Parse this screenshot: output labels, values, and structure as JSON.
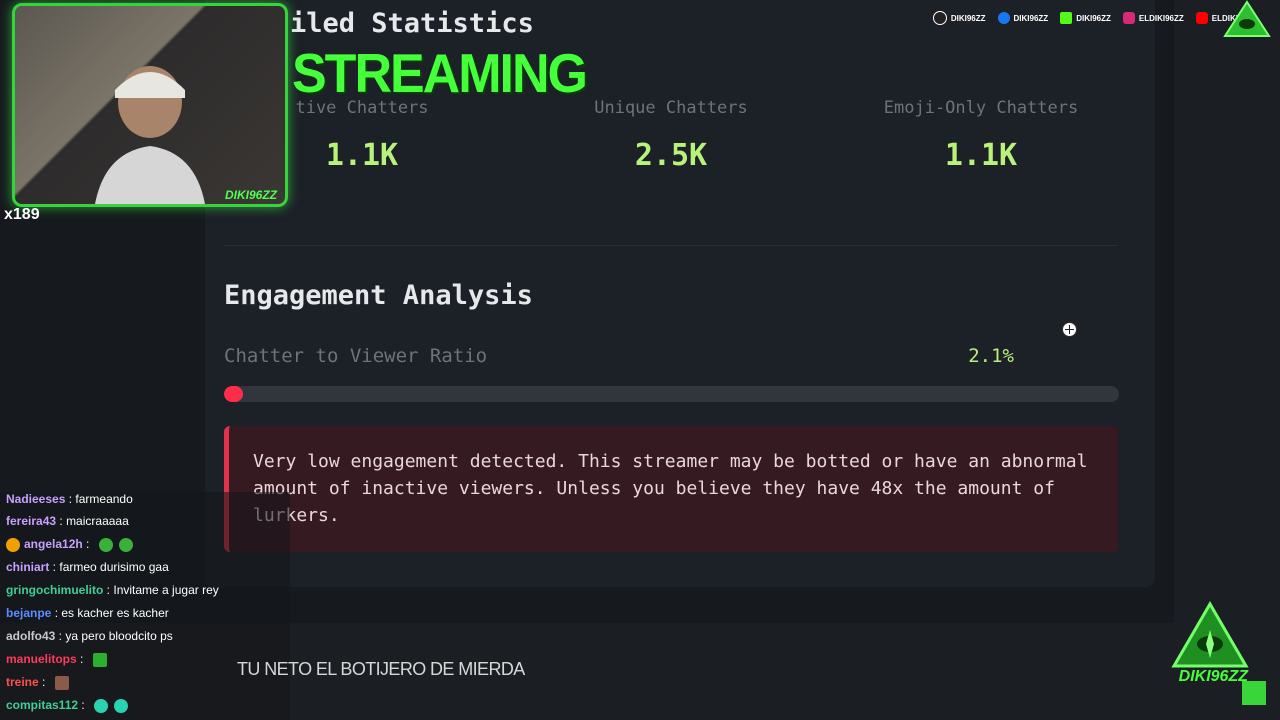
{
  "panel": {
    "title": "iled Statistics",
    "stats": [
      {
        "label": "tive Chatters",
        "value": "1.1K"
      },
      {
        "label": "Unique Chatters",
        "value": "2.5K"
      },
      {
        "label": "Emoji-Only Chatters",
        "value": "1.1K"
      }
    ],
    "engagement": {
      "title": "Engagement Analysis",
      "ratio_label": "Chatter to Viewer Ratio",
      "ratio_value": "2.1%",
      "ratio_fraction": 0.021,
      "warning": "Very low engagement detected. This streamer may be botted or have an abnormal amount of inactive viewers. Unless you believe they have 48x the amount of lurkers."
    }
  },
  "overlay": {
    "streaming_text": "STREAMING",
    "webcam_name": "DIKI96ZZ",
    "sub_count": "x189",
    "socials": [
      {
        "icon": "tiktok-icon",
        "handle": "DIKI96ZZ",
        "color": "#111111"
      },
      {
        "icon": "facebook-icon",
        "handle": "DIKI96ZZ",
        "color": "#1877f2"
      },
      {
        "icon": "kick-icon",
        "handle": "DIKI96ZZ",
        "color": "#53fc18"
      },
      {
        "icon": "instagram-icon",
        "handle": "ELDIKI96ZZ",
        "color": "#d62976"
      },
      {
        "icon": "youtube-icon",
        "handle": "ELDIKI",
        "color": "#ff0000"
      }
    ],
    "bottom_logo_text": "DIKI96ZZ",
    "caption": "TU NETO EL BOTIJERO DE MIERDA"
  },
  "chat": [
    {
      "user": "Nadieeses",
      "message": "farmeando",
      "color": "#c9a0ff"
    },
    {
      "user": "fereira43",
      "message": "maicraaaaa",
      "color": "#c9a0ff"
    },
    {
      "user": "angela12h",
      "message": "",
      "color": "#c9a0ff"
    },
    {
      "user": "chiniart",
      "message": "farmeo durisimo gaa",
      "color": "#c9a0ff"
    },
    {
      "user": "gringochimuelito",
      "message": "Invitame a jugar rey",
      "color": "#3fcf95"
    },
    {
      "user": "bejanpe",
      "message": "es kacher es kacher",
      "color": "#5a8dff"
    },
    {
      "user": "adolfo43",
      "message": "ya pero bloodcito ps",
      "color": "#c9c9c9"
    },
    {
      "user": "manuelitops",
      "message": "",
      "color": "#ff3a5a"
    },
    {
      "user": "treine",
      "message": "",
      "color": "#ff4e4e"
    },
    {
      "user": "compitas112",
      "message": "",
      "color": "#3fcf95"
    }
  ]
}
